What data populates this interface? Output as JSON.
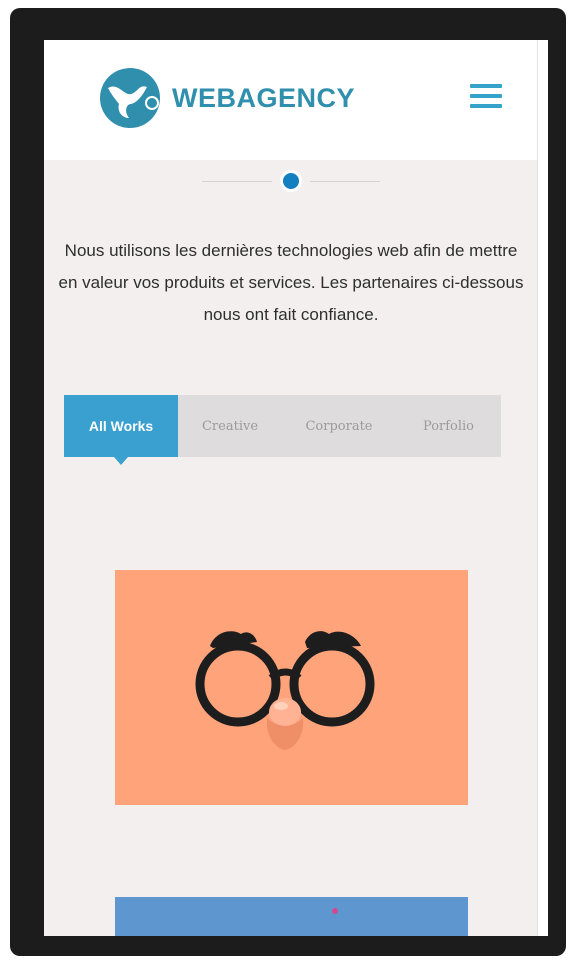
{
  "header": {
    "brand_name": "WEBAGENCY",
    "logo_icon": "webagency-logo-icon",
    "menu_icon": "hamburger-menu-icon"
  },
  "intro": {
    "text": "Nous utilisons les dernières technologies web afin de mettre en valeur vos produits et services. Les partenaires ci-dessous nous ont fait confiance."
  },
  "tabs": [
    {
      "label": "All Works",
      "active": true
    },
    {
      "label": "Creative",
      "active": false
    },
    {
      "label": "Corporate",
      "active": false
    },
    {
      "label": "Porfolio",
      "active": false
    }
  ],
  "colors": {
    "accent": "#3aa0d0",
    "brand": "#2f8fad",
    "page_background": "#f4efef",
    "card_orange": "#ffa37b",
    "card_blue": "#5e96cf"
  },
  "portfolio": {
    "items": [
      {
        "image": "disguise-glasses-illustration"
      },
      {
        "image": "blue-illustration"
      }
    ]
  }
}
